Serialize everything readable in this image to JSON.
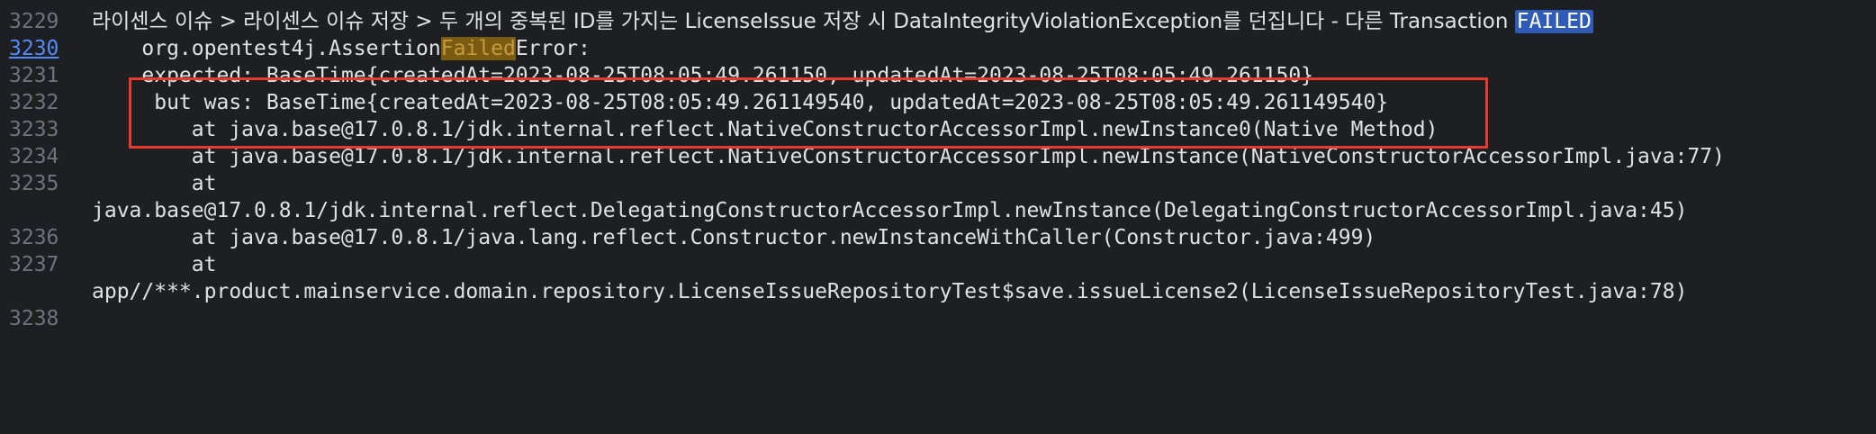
{
  "line_numbers": [
    "3229",
    "3230",
    "3231",
    "3232",
    "3233",
    "3234",
    "3235",
    "",
    "3236",
    "3237",
    "",
    "3238"
  ],
  "lines": {
    "l3229_prefix": "라이센스 이슈 > 라이센스 이슈 저장 > 두 개의 중복된 ID를 가지는 LicenseIssue 저장 시 DataIntegrityViolationException를 던집니다 - 다른 Transaction ",
    "l3229_failed": "FAILED",
    "l3230_before": "    org.opentest4j.Assertion",
    "l3230_failed": "Failed",
    "l3230_after": "Error:",
    "l3231": "    expected: BaseTime{createdAt=2023-08-25T08:05:49.261150, updatedAt=2023-08-25T08:05:49.261150}",
    "l3232": "     but was: BaseTime{createdAt=2023-08-25T08:05:49.261149540, updatedAt=2023-08-25T08:05:49.261149540}",
    "l3233": "        at java.base@17.0.8.1/jdk.internal.reflect.NativeConstructorAccessorImpl.newInstance0(Native Method)",
    "l3234": "        at java.base@17.0.8.1/jdk.internal.reflect.NativeConstructorAccessorImpl.newInstance(NativeConstructorAccessorImpl.java:77)",
    "l3235": "        at",
    "l3235_cont": "java.base@17.0.8.1/jdk.internal.reflect.DelegatingConstructorAccessorImpl.newInstance(DelegatingConstructorAccessorImpl.java:45)",
    "l3236": "        at java.base@17.0.8.1/java.lang.reflect.Constructor.newInstanceWithCaller(Constructor.java:499)",
    "l3237": "        at",
    "l3237_cont": "app//***.product.mainservice.domain.repository.LicenseIssueRepositoryTest$save.issueLicense2(LicenseIssueRepositoryTest.java:78)",
    "l3238": ""
  },
  "colors": {
    "background": "#1e1f22",
    "text": "#dfe1e5",
    "line_number": "#6f737a",
    "current_line_number": "#548af7",
    "search_highlight": "#7a5b12",
    "selected_highlight": "#2f5cb8",
    "annotation_box": "#e53a2c"
  }
}
